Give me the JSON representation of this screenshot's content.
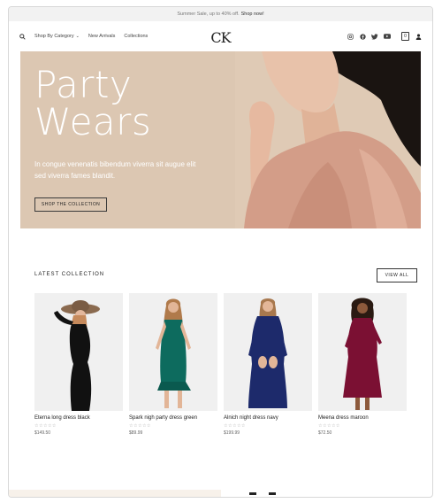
{
  "promo": {
    "text": "Summer Sale, up to 40% off.",
    "link": "Shop now!"
  },
  "header": {
    "nav": [
      {
        "label": "Shop By Category",
        "has_caret": true
      },
      {
        "label": "New Arrivals"
      },
      {
        "label": "Collections"
      }
    ],
    "logo": "CK",
    "social_icons": [
      "instagram-icon",
      "facebook-icon",
      "twitter-icon",
      "youtube-icon"
    ],
    "cart_count": "0"
  },
  "hero": {
    "title_line1": "Party",
    "title_line2": "Wears",
    "subtitle": "In congue venenatis bibendum viverra sit augue elit sed viverra fames blandit.",
    "button": "SHOP THE COLLECTION",
    "bg_color": "#dcc7b2"
  },
  "collection": {
    "title": "LATEST COLLECTION",
    "view_all": "VIEW ALL",
    "products": [
      {
        "name": "Eterna long dress black",
        "stars": "☆☆☆☆☆",
        "price": "$149.50",
        "color": "#111111"
      },
      {
        "name": "Spark nigh party dress green",
        "stars": "☆☆☆☆☆",
        "price": "$89.99",
        "color": "#0d6b5e"
      },
      {
        "name": "Alnich night dress navy",
        "stars": "☆☆☆☆☆",
        "price": "$199.99",
        "color": "#1d2a6b"
      },
      {
        "name": "Meena dress maroon",
        "stars": "☆☆☆☆☆",
        "price": "$72.50",
        "color": "#7b1033"
      }
    ]
  }
}
